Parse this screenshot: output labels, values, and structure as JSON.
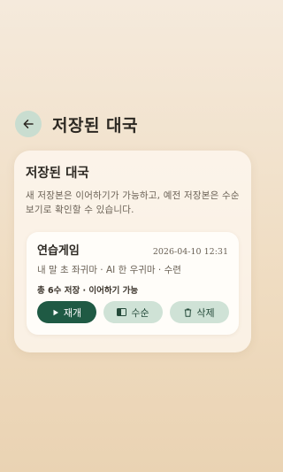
{
  "header": {
    "title": "저장된 대국",
    "back_icon": "arrow-left-icon"
  },
  "panel": {
    "title": "저장된 대국",
    "description": "새 저장본은 이어하기가 가능하고, 예전 저장본은 수순 보기로 확인할 수 있습니다."
  },
  "saved_game": {
    "title": "연습게임",
    "date": "2026-04-10 12:31",
    "subtitle": "내 말 초 좌귀마 · AI 한 우귀마 · 수련",
    "meta": "총 6수 저장 · 이어하기 가능",
    "actions": {
      "resume_label": "재개",
      "moves_label": "수순",
      "delete_label": "삭제"
    }
  },
  "colors": {
    "primary": "#1f5a44",
    "secondary": "#cfe2d6",
    "back_button": "#c9ddd0"
  }
}
